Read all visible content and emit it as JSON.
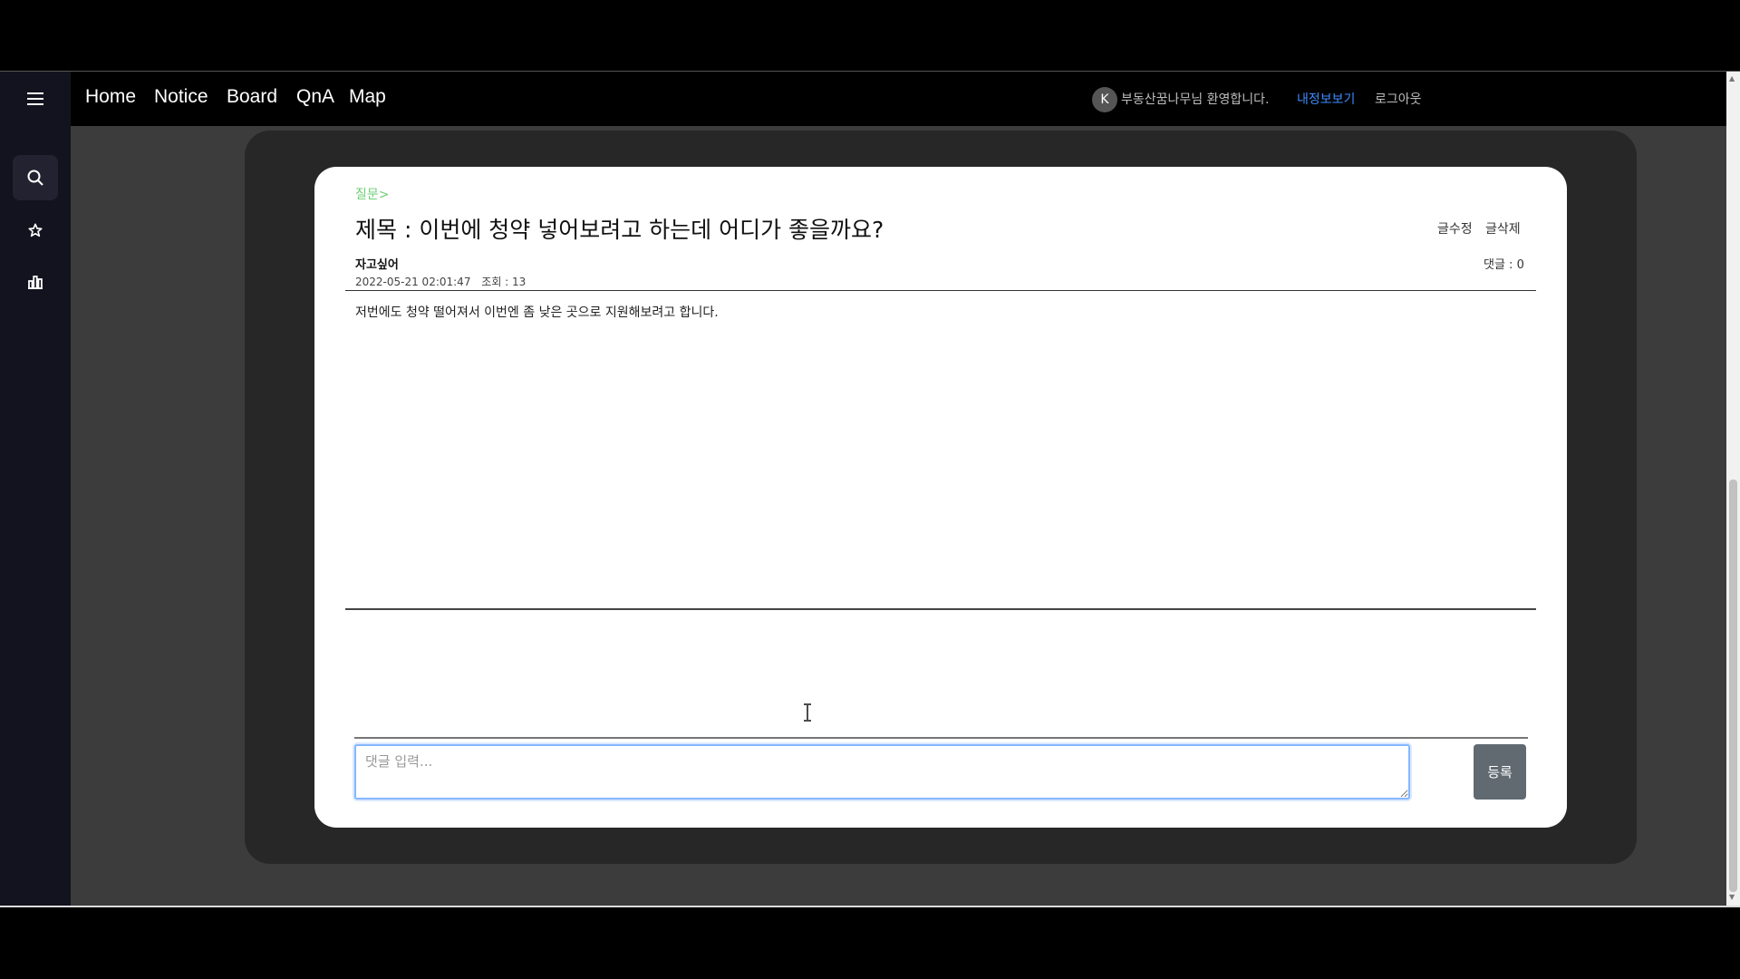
{
  "nav": {
    "links": [
      "Home",
      "Notice",
      "Board",
      "QnA",
      "Map"
    ],
    "user_initial": "K",
    "welcome": "부동산꿈나무님 환영합니다.",
    "mypage": "내정보보기",
    "logout": "로그아웃"
  },
  "sidebar": {
    "icons": [
      "menu-icon",
      "search-icon",
      "star-icon",
      "chart-icon"
    ]
  },
  "post": {
    "category": "질문>",
    "title": "제목 : 이번에 청약 넣어보려고 하는데 어디가 좋을까요?",
    "edit": "글수정",
    "delete": "글삭제",
    "author": "자고싶어",
    "date": "2022-05-21 02:01:47",
    "views": "조회 : 13",
    "comments": "댓글 : 0",
    "body": "저번에도 청약 떨어져서 이번엔 좀 낮은 곳으로 지원해보려고 합니다."
  },
  "comment": {
    "placeholder": "댓글 입력...",
    "submit": "등록"
  },
  "colors": {
    "accent_link": "#3d8bfd",
    "category": "#6ecf74",
    "submit_bg": "#606a70"
  }
}
